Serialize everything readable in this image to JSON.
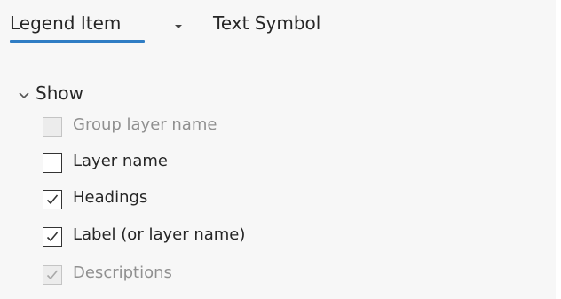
{
  "tabs": [
    {
      "label": "Legend Item",
      "active": true
    },
    {
      "label": "Text Symbol",
      "active": false
    }
  ],
  "icons": {
    "tab_dropdown": "caret-down-icon",
    "section_toggle": "chevron-down-icon",
    "check": "checkmark-icon"
  },
  "colors": {
    "accent": "#2f7dc4",
    "panel_background": "#f7f7f7",
    "text": "#262626",
    "disabled_text": "#909090"
  },
  "show_section": {
    "label": "Show",
    "expanded": true,
    "options": [
      {
        "label": "Group layer name",
        "checked": false,
        "enabled": false
      },
      {
        "label": "Layer name",
        "checked": false,
        "enabled": true
      },
      {
        "label": "Headings",
        "checked": true,
        "enabled": true
      },
      {
        "label": "Label (or layer name)",
        "checked": true,
        "enabled": true
      },
      {
        "label": "Descriptions",
        "checked": true,
        "enabled": false
      }
    ]
  }
}
